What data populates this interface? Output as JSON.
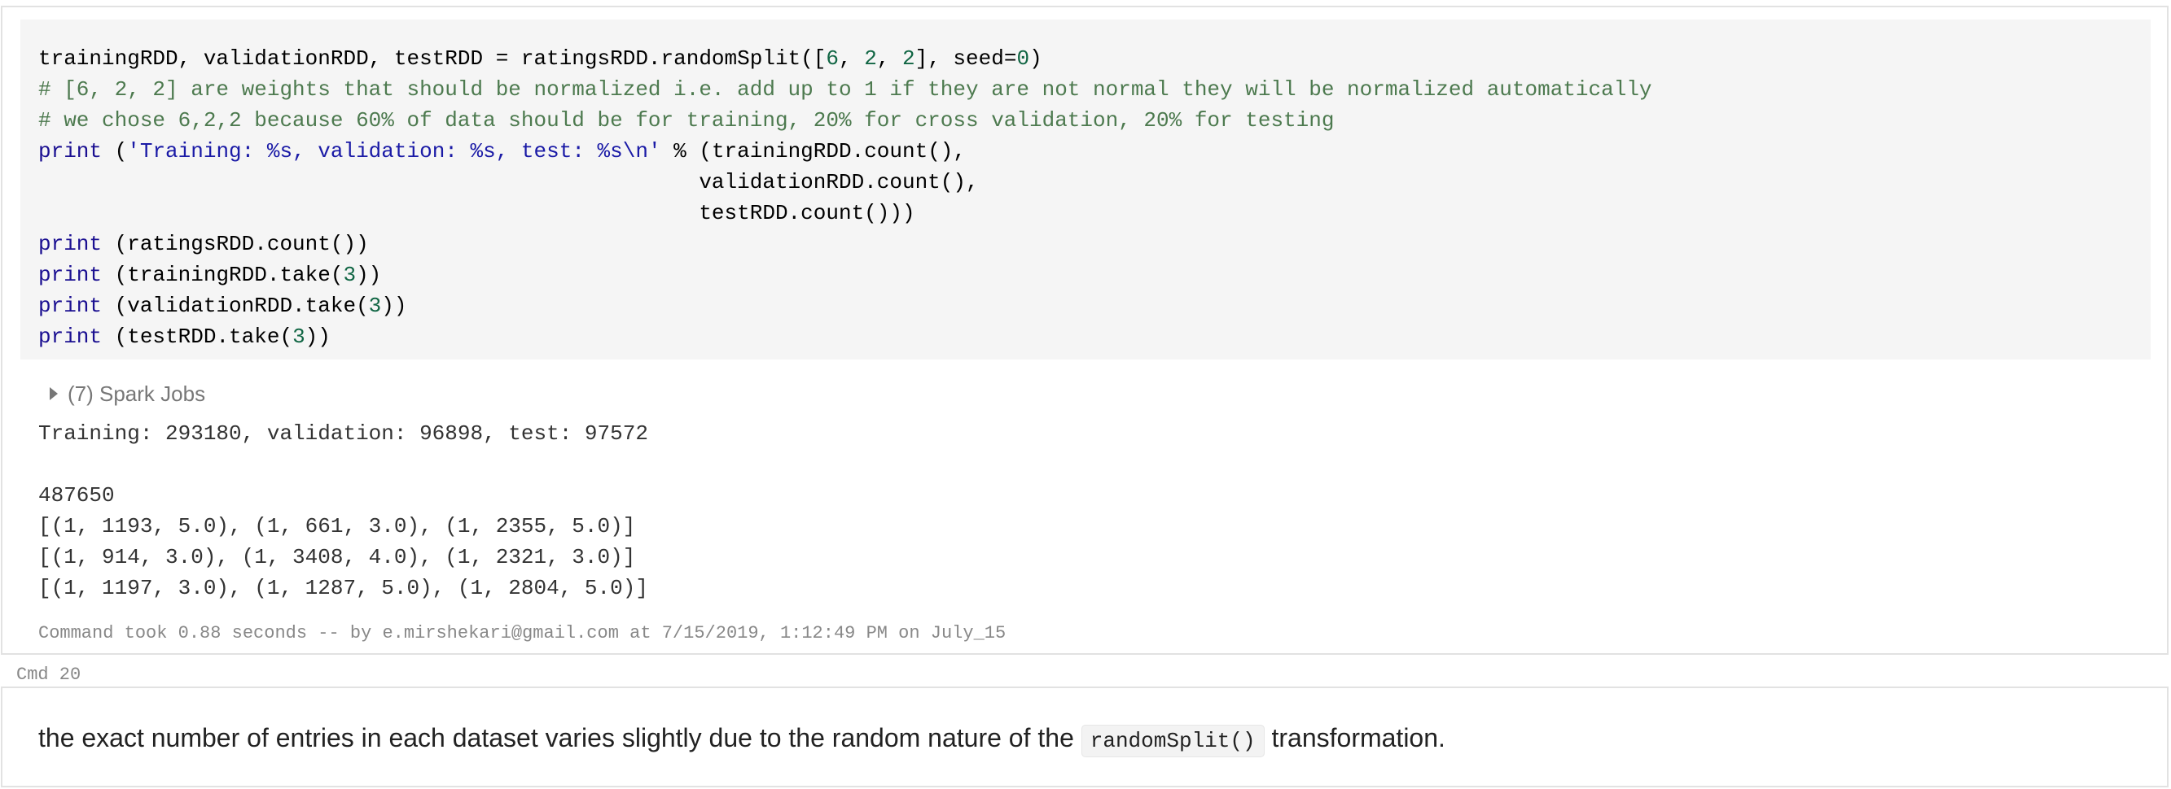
{
  "cell_19": {
    "code_lines": [
      [
        {
          "c": "plain",
          "t": "trainingRDD, validationRDD, testRDD = ratingsRDD.randomSplit(["
        },
        {
          "c": "num",
          "t": "6"
        },
        {
          "c": "plain",
          "t": ", "
        },
        {
          "c": "num",
          "t": "2"
        },
        {
          "c": "plain",
          "t": ", "
        },
        {
          "c": "num",
          "t": "2"
        },
        {
          "c": "plain",
          "t": "], seed="
        },
        {
          "c": "num",
          "t": "0"
        },
        {
          "c": "plain",
          "t": ")"
        }
      ],
      [
        {
          "c": "cmt",
          "t": "# [6, 2, 2] are weights that should be normalized i.e. add up to 1 if they are not normal they will be normalized automatically"
        }
      ],
      [
        {
          "c": "cmt",
          "t": "# we chose 6,2,2 because 60% of data should be for training, 20% for cross validation, 20% for testing"
        }
      ],
      [
        {
          "c": "kw",
          "t": "print"
        },
        {
          "c": "plain",
          "t": " ("
        },
        {
          "c": "str",
          "t": "'Training: %s, validation: %s, test: %s\\n'"
        },
        {
          "c": "plain",
          "t": " % (trainingRDD.count(),"
        }
      ],
      [
        {
          "c": "plain",
          "t": "                                                    validationRDD.count(),"
        }
      ],
      [
        {
          "c": "plain",
          "t": "                                                    testRDD.count()))"
        }
      ],
      [
        {
          "c": "kw",
          "t": "print"
        },
        {
          "c": "plain",
          "t": " (ratingsRDD.count())"
        }
      ],
      [
        {
          "c": "kw",
          "t": "print"
        },
        {
          "c": "plain",
          "t": " (trainingRDD.take("
        },
        {
          "c": "num",
          "t": "3"
        },
        {
          "c": "plain",
          "t": "))"
        }
      ],
      [
        {
          "c": "kw",
          "t": "print"
        },
        {
          "c": "plain",
          "t": " (validationRDD.take("
        },
        {
          "c": "num",
          "t": "3"
        },
        {
          "c": "plain",
          "t": "))"
        }
      ],
      [
        {
          "c": "kw",
          "t": "print"
        },
        {
          "c": "plain",
          "t": " (testRDD.take("
        },
        {
          "c": "num",
          "t": "3"
        },
        {
          "c": "plain",
          "t": "))"
        }
      ]
    ],
    "spark_jobs_label": "(7) Spark Jobs",
    "output_lines": [
      "Training: 293180, validation: 96898, test: 97572",
      "",
      "487650",
      "[(1, 1193, 5.0), (1, 661, 3.0), (1, 2355, 5.0)]",
      "[(1, 914, 3.0), (1, 3408, 4.0), (1, 2321, 3.0)]",
      "[(1, 1197, 3.0), (1, 1287, 5.0), (1, 2804, 5.0)]"
    ],
    "status": "Command took 0.88 seconds -- by e.mirshekari@gmail.com at 7/15/2019, 1:12:49 PM on July_15"
  },
  "cmd_label": "Cmd 20",
  "cell_20": {
    "text_before": "the exact number of entries in each dataset varies slightly due to the random nature of the ",
    "inline_code": "randomSplit()",
    "text_after": " transformation."
  },
  "colors": {
    "keyword": "#1a0f91",
    "string": "#1a1aa6",
    "comment": "#4d7a4f",
    "number": "#116644",
    "code_background": "#f5f5f5",
    "cell_border": "#e2e2e2"
  },
  "icons": {
    "spark_jobs_toggle": "caret-right-icon"
  }
}
